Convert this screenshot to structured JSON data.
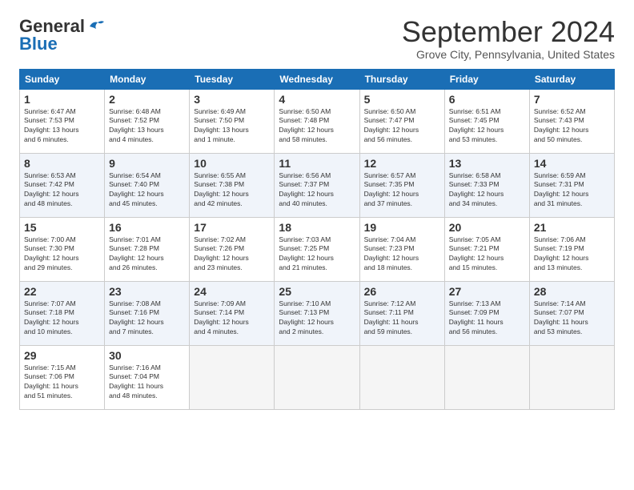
{
  "header": {
    "logo_line1": "General",
    "logo_line2": "Blue",
    "month": "September 2024",
    "location": "Grove City, Pennsylvania, United States"
  },
  "days_of_week": [
    "Sunday",
    "Monday",
    "Tuesday",
    "Wednesday",
    "Thursday",
    "Friday",
    "Saturday"
  ],
  "weeks": [
    [
      {
        "date": "1",
        "info": "Sunrise: 6:47 AM\nSunset: 7:53 PM\nDaylight: 13 hours\nand 6 minutes."
      },
      {
        "date": "2",
        "info": "Sunrise: 6:48 AM\nSunset: 7:52 PM\nDaylight: 13 hours\nand 4 minutes."
      },
      {
        "date": "3",
        "info": "Sunrise: 6:49 AM\nSunset: 7:50 PM\nDaylight: 13 hours\nand 1 minute."
      },
      {
        "date": "4",
        "info": "Sunrise: 6:50 AM\nSunset: 7:48 PM\nDaylight: 12 hours\nand 58 minutes."
      },
      {
        "date": "5",
        "info": "Sunrise: 6:50 AM\nSunset: 7:47 PM\nDaylight: 12 hours\nand 56 minutes."
      },
      {
        "date": "6",
        "info": "Sunrise: 6:51 AM\nSunset: 7:45 PM\nDaylight: 12 hours\nand 53 minutes."
      },
      {
        "date": "7",
        "info": "Sunrise: 6:52 AM\nSunset: 7:43 PM\nDaylight: 12 hours\nand 50 minutes."
      }
    ],
    [
      {
        "date": "8",
        "info": "Sunrise: 6:53 AM\nSunset: 7:42 PM\nDaylight: 12 hours\nand 48 minutes."
      },
      {
        "date": "9",
        "info": "Sunrise: 6:54 AM\nSunset: 7:40 PM\nDaylight: 12 hours\nand 45 minutes."
      },
      {
        "date": "10",
        "info": "Sunrise: 6:55 AM\nSunset: 7:38 PM\nDaylight: 12 hours\nand 42 minutes."
      },
      {
        "date": "11",
        "info": "Sunrise: 6:56 AM\nSunset: 7:37 PM\nDaylight: 12 hours\nand 40 minutes."
      },
      {
        "date": "12",
        "info": "Sunrise: 6:57 AM\nSunset: 7:35 PM\nDaylight: 12 hours\nand 37 minutes."
      },
      {
        "date": "13",
        "info": "Sunrise: 6:58 AM\nSunset: 7:33 PM\nDaylight: 12 hours\nand 34 minutes."
      },
      {
        "date": "14",
        "info": "Sunrise: 6:59 AM\nSunset: 7:31 PM\nDaylight: 12 hours\nand 31 minutes."
      }
    ],
    [
      {
        "date": "15",
        "info": "Sunrise: 7:00 AM\nSunset: 7:30 PM\nDaylight: 12 hours\nand 29 minutes."
      },
      {
        "date": "16",
        "info": "Sunrise: 7:01 AM\nSunset: 7:28 PM\nDaylight: 12 hours\nand 26 minutes."
      },
      {
        "date": "17",
        "info": "Sunrise: 7:02 AM\nSunset: 7:26 PM\nDaylight: 12 hours\nand 23 minutes."
      },
      {
        "date": "18",
        "info": "Sunrise: 7:03 AM\nSunset: 7:25 PM\nDaylight: 12 hours\nand 21 minutes."
      },
      {
        "date": "19",
        "info": "Sunrise: 7:04 AM\nSunset: 7:23 PM\nDaylight: 12 hours\nand 18 minutes."
      },
      {
        "date": "20",
        "info": "Sunrise: 7:05 AM\nSunset: 7:21 PM\nDaylight: 12 hours\nand 15 minutes."
      },
      {
        "date": "21",
        "info": "Sunrise: 7:06 AM\nSunset: 7:19 PM\nDaylight: 12 hours\nand 13 minutes."
      }
    ],
    [
      {
        "date": "22",
        "info": "Sunrise: 7:07 AM\nSunset: 7:18 PM\nDaylight: 12 hours\nand 10 minutes."
      },
      {
        "date": "23",
        "info": "Sunrise: 7:08 AM\nSunset: 7:16 PM\nDaylight: 12 hours\nand 7 minutes."
      },
      {
        "date": "24",
        "info": "Sunrise: 7:09 AM\nSunset: 7:14 PM\nDaylight: 12 hours\nand 4 minutes."
      },
      {
        "date": "25",
        "info": "Sunrise: 7:10 AM\nSunset: 7:13 PM\nDaylight: 12 hours\nand 2 minutes."
      },
      {
        "date": "26",
        "info": "Sunrise: 7:12 AM\nSunset: 7:11 PM\nDaylight: 11 hours\nand 59 minutes."
      },
      {
        "date": "27",
        "info": "Sunrise: 7:13 AM\nSunset: 7:09 PM\nDaylight: 11 hours\nand 56 minutes."
      },
      {
        "date": "28",
        "info": "Sunrise: 7:14 AM\nSunset: 7:07 PM\nDaylight: 11 hours\nand 53 minutes."
      }
    ],
    [
      {
        "date": "29",
        "info": "Sunrise: 7:15 AM\nSunset: 7:06 PM\nDaylight: 11 hours\nand 51 minutes."
      },
      {
        "date": "30",
        "info": "Sunrise: 7:16 AM\nSunset: 7:04 PM\nDaylight: 11 hours\nand 48 minutes."
      },
      {
        "date": "",
        "info": ""
      },
      {
        "date": "",
        "info": ""
      },
      {
        "date": "",
        "info": ""
      },
      {
        "date": "",
        "info": ""
      },
      {
        "date": "",
        "info": ""
      }
    ]
  ]
}
